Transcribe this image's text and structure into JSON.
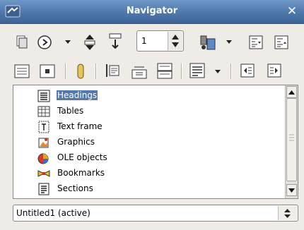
{
  "window": {
    "title": "Navigator"
  },
  "toolbar": {
    "page_number": "1"
  },
  "list": {
    "items": [
      {
        "label": "Headings",
        "icon": "headings-icon",
        "selected": true
      },
      {
        "label": "Tables",
        "icon": "table-icon",
        "selected": false
      },
      {
        "label": "Text frame",
        "icon": "text-frame-icon",
        "selected": false
      },
      {
        "label": "Graphics",
        "icon": "graphics-icon",
        "selected": false
      },
      {
        "label": "OLE objects",
        "icon": "ole-objects-icon",
        "selected": false
      },
      {
        "label": "Bookmarks",
        "icon": "bookmark-icon",
        "selected": false
      },
      {
        "label": "Sections",
        "icon": "sections-icon",
        "selected": false
      }
    ]
  },
  "document_select": {
    "value": "Untitled1 (active)"
  },
  "colors": {
    "titlebar": "#5a82b4",
    "selection": "#5179ac",
    "window_bg": "#efebe7"
  }
}
